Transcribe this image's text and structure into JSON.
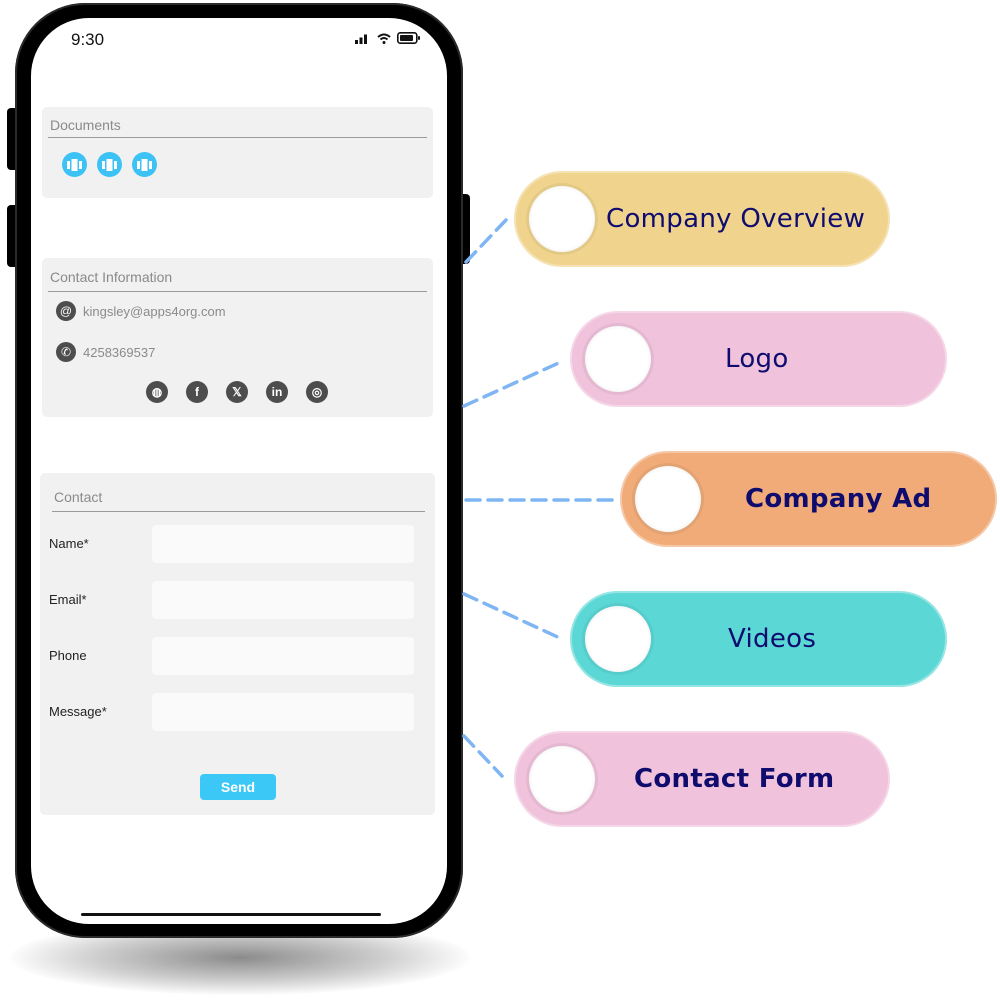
{
  "status_bar": {
    "time": "9:30",
    "icons": [
      "signal-icon",
      "wifi-icon",
      "battery-icon"
    ]
  },
  "documents": {
    "title": "Documents",
    "items": [
      "document-icon",
      "document-icon",
      "document-icon"
    ]
  },
  "contact_info": {
    "title": "Contact Information",
    "email": "kingsley@apps4org.com",
    "phone": "4258369537",
    "socials": [
      {
        "name": "website",
        "glyph": "◍"
      },
      {
        "name": "facebook",
        "glyph": "f"
      },
      {
        "name": "x",
        "glyph": "𝕏"
      },
      {
        "name": "linkedin",
        "glyph": "in"
      },
      {
        "name": "instagram",
        "glyph": "◎"
      }
    ]
  },
  "contact_form": {
    "title": "Contact",
    "fields": [
      {
        "label": "Name*",
        "value": "",
        "placeholder": ""
      },
      {
        "label": "Email*",
        "value": "",
        "placeholder": ""
      },
      {
        "label": "Phone",
        "value": "",
        "placeholder": ""
      },
      {
        "label": "Message*",
        "value": "",
        "placeholder": ""
      }
    ],
    "submit_label": "Send"
  },
  "callouts": [
    {
      "label": "Company Overview",
      "color": "#f0d48e"
    },
    {
      "label": "Logo",
      "color": "#f0c2dc"
    },
    {
      "label": "Company Ad",
      "color": "#f0ab79"
    },
    {
      "label": "Videos",
      "color": "#5bd7d6"
    },
    {
      "label": "Contact Form",
      "color": "#f0c2dc"
    }
  ],
  "colors": {
    "accent": "#3cc2f4",
    "connector": "#7fb5f2",
    "label_text": "#0f0c6e"
  }
}
